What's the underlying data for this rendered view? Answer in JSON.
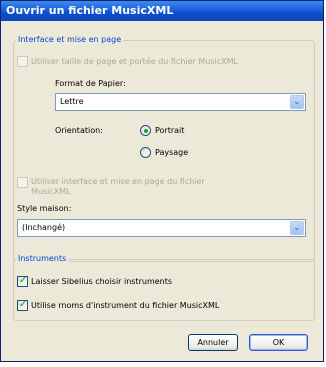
{
  "window": {
    "title": "Ouvrir un fichier MusicXML"
  },
  "layout_group": {
    "legend": "Interface et mise en page",
    "use_page_size_label": "Utiliser taille de page et portée du fichier MusicXML",
    "paper_format_label": "Format de Papier:",
    "paper_format_value": "Lettre",
    "orientation_label": "Orientation:",
    "portrait_label": "Portrait",
    "landscape_label": "Paysage",
    "use_interface_label_line1": "Utiliser interface et mise en page du fichier",
    "use_interface_label_line2": "MusicXML",
    "house_style_label": "Style maison:",
    "house_style_value": "(Inchangé)"
  },
  "instruments_group": {
    "legend": "Instruments",
    "let_sibelius_label": "Laisser Sibelius choisir instruments",
    "use_names_label": "Utilise rnoms d'instrument du fichier MusicXML"
  },
  "buttons": {
    "cancel_label": "Annuler",
    "ok_label": "OK"
  },
  "state": {
    "orientation_selected": "Portrait",
    "let_sibelius_checked": true,
    "use_names_checked": true
  },
  "colors": {
    "title_bar": "#0a4fd0",
    "group_legend": "#0046d5",
    "check_mark": "#21a121",
    "dialog_bg": "#ece9d8"
  },
  "icons": {
    "dropdown": "chevron-down-icon",
    "check": "check-icon"
  }
}
